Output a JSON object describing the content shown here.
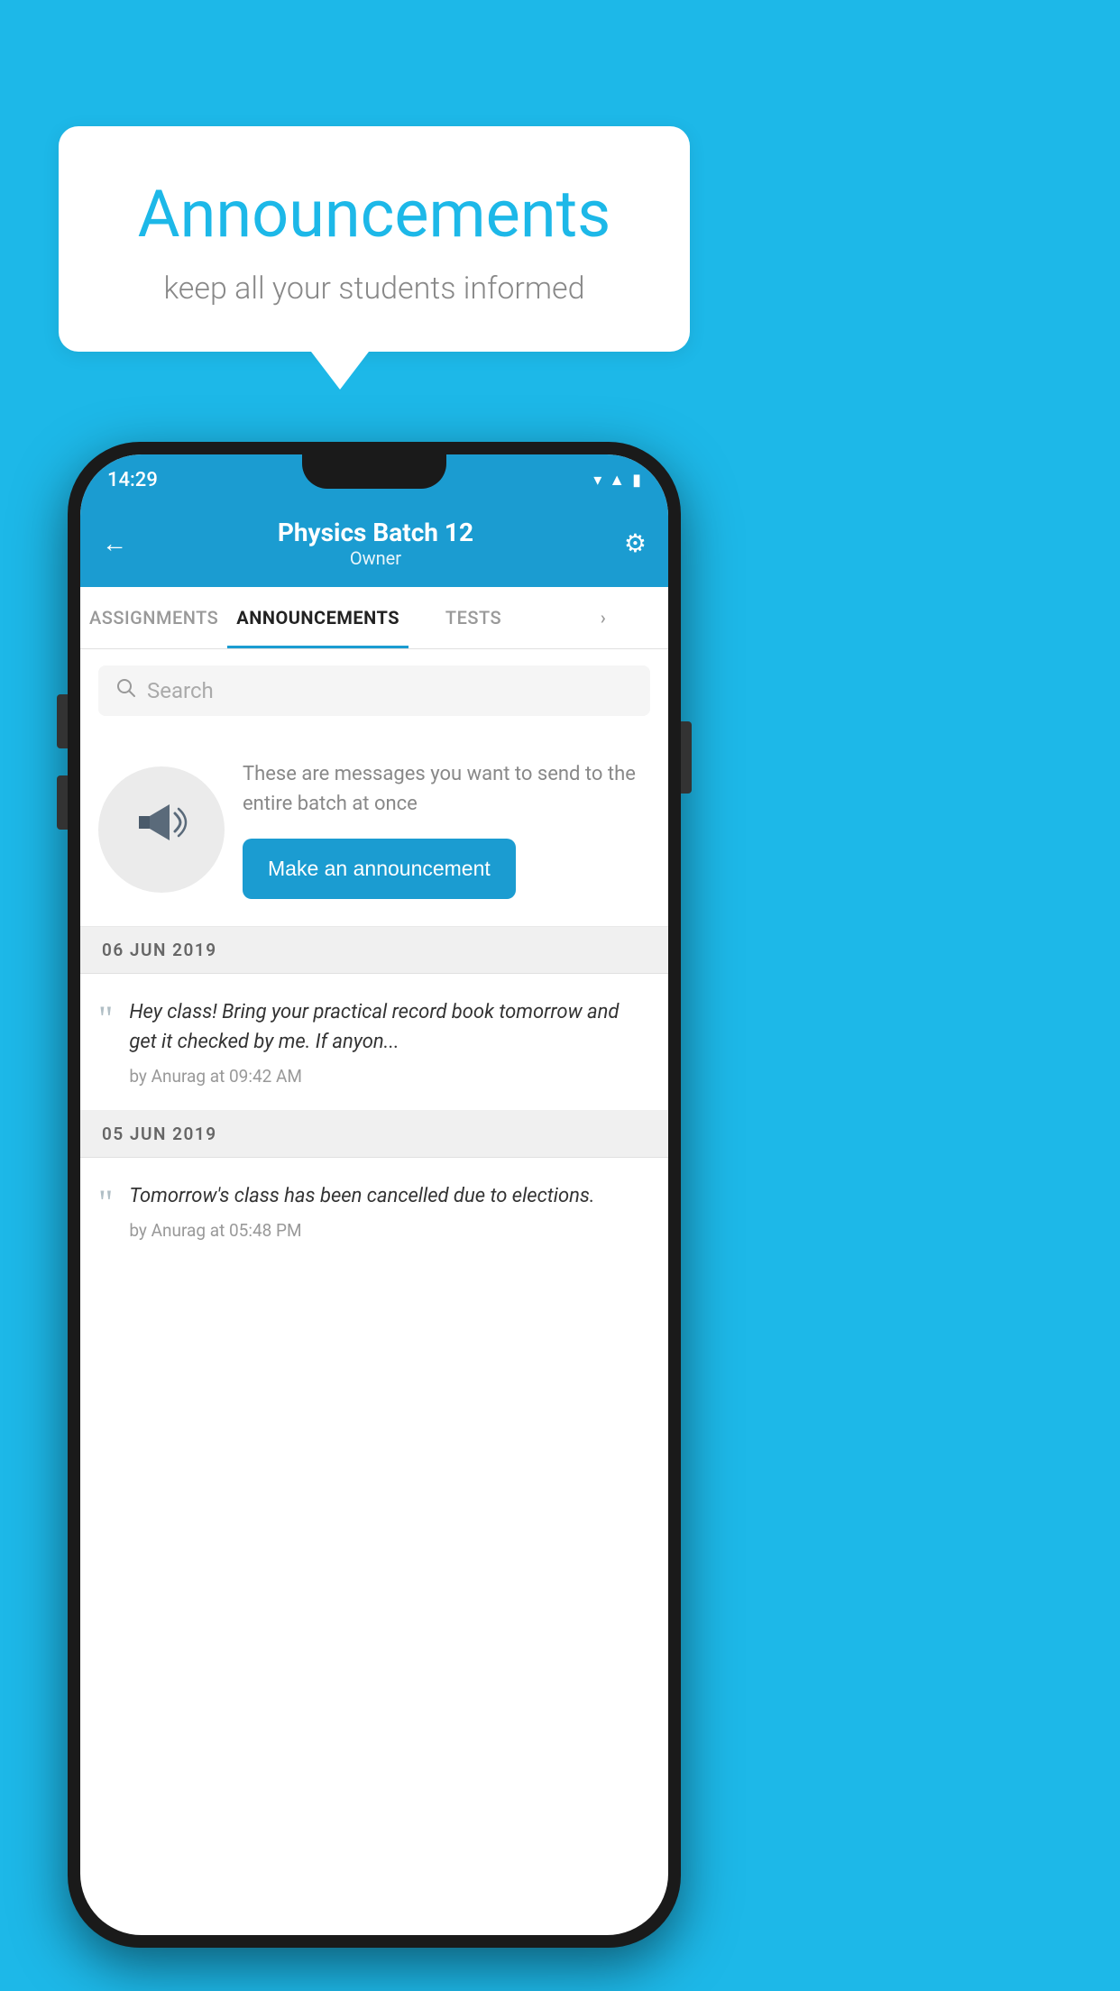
{
  "background_color": "#1DB8E8",
  "speech_bubble": {
    "title": "Announcements",
    "subtitle": "keep all your students informed"
  },
  "phone": {
    "status_bar": {
      "time": "14:29",
      "icons": [
        "wifi",
        "signal",
        "battery"
      ]
    },
    "header": {
      "title": "Physics Batch 12",
      "subtitle": "Owner",
      "back_label": "←",
      "settings_label": "⚙"
    },
    "tabs": [
      {
        "label": "ASSIGNMENTS",
        "active": false
      },
      {
        "label": "ANNOUNCEMENTS",
        "active": true
      },
      {
        "label": "TESTS",
        "active": false
      },
      {
        "label": "",
        "active": false
      }
    ],
    "search": {
      "placeholder": "Search"
    },
    "promo": {
      "description": "These are messages you want to send to the entire batch at once",
      "button_label": "Make an announcement"
    },
    "announcements": [
      {
        "date": "06  JUN  2019",
        "text": "Hey class! Bring your practical record book tomorrow and get it checked by me. If anyon...",
        "meta": "by Anurag at 09:42 AM"
      },
      {
        "date": "05  JUN  2019",
        "text": "Tomorrow's class has been cancelled due to elections.",
        "meta": "by Anurag at 05:48 PM"
      }
    ]
  }
}
